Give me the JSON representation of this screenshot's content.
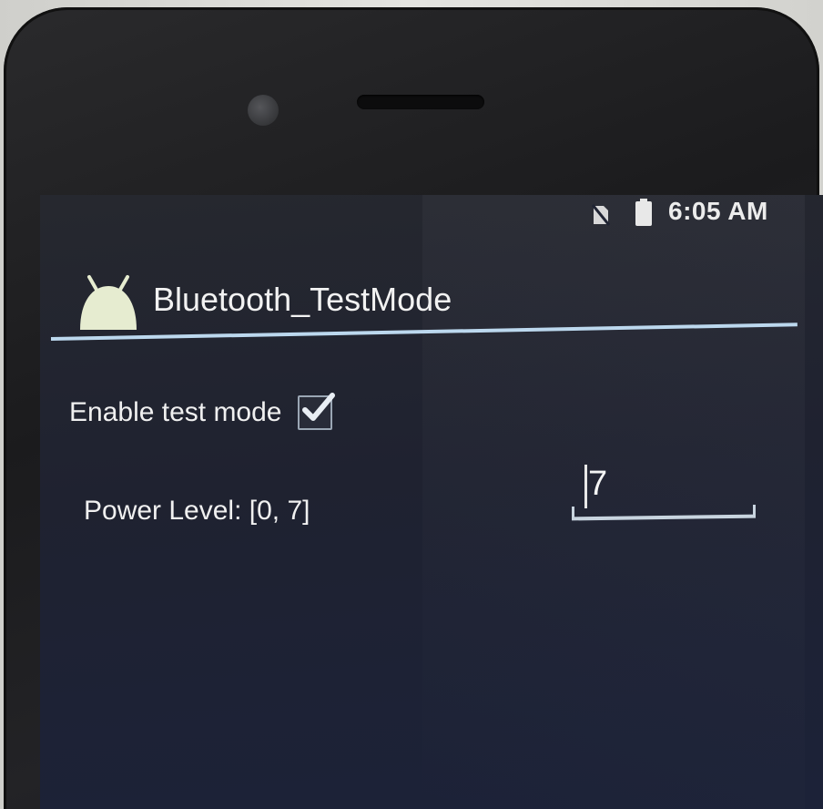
{
  "statusbar": {
    "time": "6:05 AM",
    "icons": [
      "no-sim-icon",
      "battery-icon"
    ]
  },
  "app": {
    "title": "Bluetooth_TestMode",
    "icon": "android-icon"
  },
  "settings": {
    "enable_test_mode": {
      "label": "Enable test mode",
      "checked": true
    },
    "power_level": {
      "label": "Power Level: [0, 7]",
      "value": "7"
    }
  },
  "colors": {
    "screen_bg": "#1f2230",
    "divider": "#bcd8ee",
    "android_icon": "#e6ecd0"
  }
}
